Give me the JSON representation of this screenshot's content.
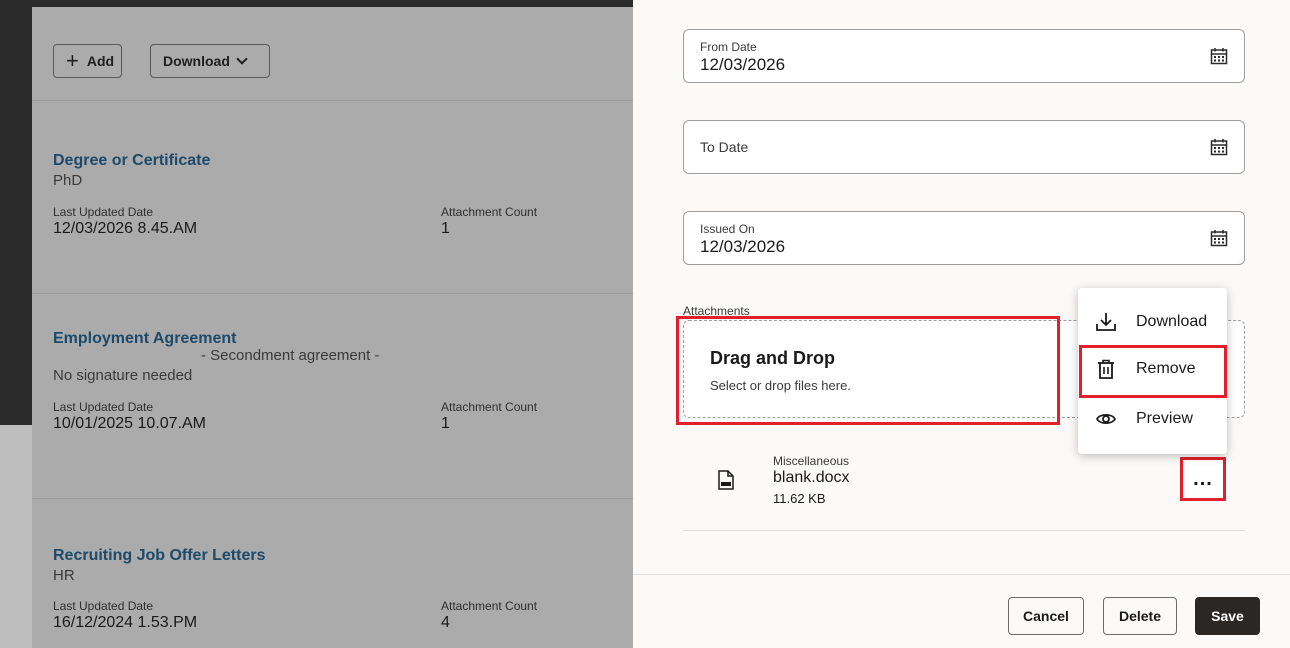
{
  "toolbar": {
    "add_label": "Add",
    "download_label": "Download"
  },
  "cards": [
    {
      "title": "Degree or Certificate",
      "subtitle": "PhD",
      "last_updated_label": "Last Updated Date",
      "last_updated_value": "12/03/2026 8.45.AM",
      "attachment_count_label": "Attachment Count",
      "attachment_count_value": "1"
    },
    {
      "title": "Employment Agreement",
      "subtitle_mid": "- Secondment agreement -",
      "subtitle": "No signature needed",
      "last_updated_label": "Last Updated Date",
      "last_updated_value": "10/01/2025 10.07.AM",
      "attachment_count_label": "Attachment Count",
      "attachment_count_value": "1"
    },
    {
      "title": "Recruiting Job Offer Letters",
      "subtitle": "HR",
      "last_updated_label": "Last Updated Date",
      "last_updated_value": "16/12/2024 1.53.PM",
      "attachment_count_label": "Attachment Count",
      "attachment_count_value": "4"
    }
  ],
  "form": {
    "from_date": {
      "label": "From Date",
      "value": "12/03/2026"
    },
    "to_date": {
      "label": "To Date",
      "value": ""
    },
    "issued_on": {
      "label": "Issued On",
      "value": "12/03/2026"
    }
  },
  "attachments": {
    "label": "Attachments",
    "dropzone_title": "Drag and Drop",
    "dropzone_sub": "Select or drop files here.",
    "file": {
      "category": "Miscellaneous",
      "name": "blank.docx",
      "size": "11.62 KB"
    },
    "more_label": "..."
  },
  "menu": {
    "download": "Download",
    "remove": "Remove",
    "preview": "Preview"
  },
  "footer": {
    "cancel": "Cancel",
    "delete": "Delete",
    "save": "Save"
  },
  "colors": {
    "highlight": "#e0202c",
    "link_title": "#1d4a6b",
    "save_bg": "#2a2724"
  }
}
